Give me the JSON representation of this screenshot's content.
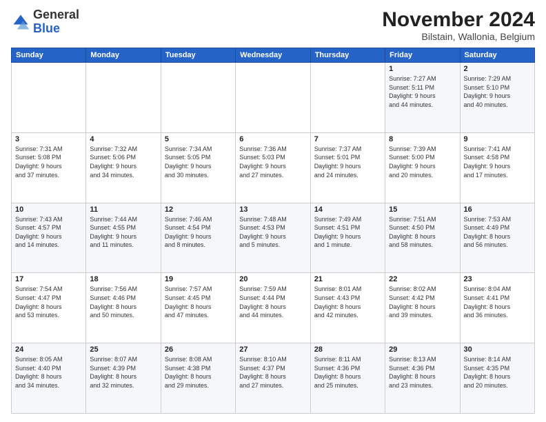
{
  "logo": {
    "general": "General",
    "blue": "Blue"
  },
  "title": "November 2024",
  "location": "Bilstain, Wallonia, Belgium",
  "headers": [
    "Sunday",
    "Monday",
    "Tuesday",
    "Wednesday",
    "Thursday",
    "Friday",
    "Saturday"
  ],
  "weeks": [
    [
      {
        "day": "",
        "info": ""
      },
      {
        "day": "",
        "info": ""
      },
      {
        "day": "",
        "info": ""
      },
      {
        "day": "",
        "info": ""
      },
      {
        "day": "",
        "info": ""
      },
      {
        "day": "1",
        "info": "Sunrise: 7:27 AM\nSunset: 5:11 PM\nDaylight: 9 hours\nand 44 minutes."
      },
      {
        "day": "2",
        "info": "Sunrise: 7:29 AM\nSunset: 5:10 PM\nDaylight: 9 hours\nand 40 minutes."
      }
    ],
    [
      {
        "day": "3",
        "info": "Sunrise: 7:31 AM\nSunset: 5:08 PM\nDaylight: 9 hours\nand 37 minutes."
      },
      {
        "day": "4",
        "info": "Sunrise: 7:32 AM\nSunset: 5:06 PM\nDaylight: 9 hours\nand 34 minutes."
      },
      {
        "day": "5",
        "info": "Sunrise: 7:34 AM\nSunset: 5:05 PM\nDaylight: 9 hours\nand 30 minutes."
      },
      {
        "day": "6",
        "info": "Sunrise: 7:36 AM\nSunset: 5:03 PM\nDaylight: 9 hours\nand 27 minutes."
      },
      {
        "day": "7",
        "info": "Sunrise: 7:37 AM\nSunset: 5:01 PM\nDaylight: 9 hours\nand 24 minutes."
      },
      {
        "day": "8",
        "info": "Sunrise: 7:39 AM\nSunset: 5:00 PM\nDaylight: 9 hours\nand 20 minutes."
      },
      {
        "day": "9",
        "info": "Sunrise: 7:41 AM\nSunset: 4:58 PM\nDaylight: 9 hours\nand 17 minutes."
      }
    ],
    [
      {
        "day": "10",
        "info": "Sunrise: 7:43 AM\nSunset: 4:57 PM\nDaylight: 9 hours\nand 14 minutes."
      },
      {
        "day": "11",
        "info": "Sunrise: 7:44 AM\nSunset: 4:55 PM\nDaylight: 9 hours\nand 11 minutes."
      },
      {
        "day": "12",
        "info": "Sunrise: 7:46 AM\nSunset: 4:54 PM\nDaylight: 9 hours\nand 8 minutes."
      },
      {
        "day": "13",
        "info": "Sunrise: 7:48 AM\nSunset: 4:53 PM\nDaylight: 9 hours\nand 5 minutes."
      },
      {
        "day": "14",
        "info": "Sunrise: 7:49 AM\nSunset: 4:51 PM\nDaylight: 9 hours\nand 1 minute."
      },
      {
        "day": "15",
        "info": "Sunrise: 7:51 AM\nSunset: 4:50 PM\nDaylight: 8 hours\nand 58 minutes."
      },
      {
        "day": "16",
        "info": "Sunrise: 7:53 AM\nSunset: 4:49 PM\nDaylight: 8 hours\nand 56 minutes."
      }
    ],
    [
      {
        "day": "17",
        "info": "Sunrise: 7:54 AM\nSunset: 4:47 PM\nDaylight: 8 hours\nand 53 minutes."
      },
      {
        "day": "18",
        "info": "Sunrise: 7:56 AM\nSunset: 4:46 PM\nDaylight: 8 hours\nand 50 minutes."
      },
      {
        "day": "19",
        "info": "Sunrise: 7:57 AM\nSunset: 4:45 PM\nDaylight: 8 hours\nand 47 minutes."
      },
      {
        "day": "20",
        "info": "Sunrise: 7:59 AM\nSunset: 4:44 PM\nDaylight: 8 hours\nand 44 minutes."
      },
      {
        "day": "21",
        "info": "Sunrise: 8:01 AM\nSunset: 4:43 PM\nDaylight: 8 hours\nand 42 minutes."
      },
      {
        "day": "22",
        "info": "Sunrise: 8:02 AM\nSunset: 4:42 PM\nDaylight: 8 hours\nand 39 minutes."
      },
      {
        "day": "23",
        "info": "Sunrise: 8:04 AM\nSunset: 4:41 PM\nDaylight: 8 hours\nand 36 minutes."
      }
    ],
    [
      {
        "day": "24",
        "info": "Sunrise: 8:05 AM\nSunset: 4:40 PM\nDaylight: 8 hours\nand 34 minutes."
      },
      {
        "day": "25",
        "info": "Sunrise: 8:07 AM\nSunset: 4:39 PM\nDaylight: 8 hours\nand 32 minutes."
      },
      {
        "day": "26",
        "info": "Sunrise: 8:08 AM\nSunset: 4:38 PM\nDaylight: 8 hours\nand 29 minutes."
      },
      {
        "day": "27",
        "info": "Sunrise: 8:10 AM\nSunset: 4:37 PM\nDaylight: 8 hours\nand 27 minutes."
      },
      {
        "day": "28",
        "info": "Sunrise: 8:11 AM\nSunset: 4:36 PM\nDaylight: 8 hours\nand 25 minutes."
      },
      {
        "day": "29",
        "info": "Sunrise: 8:13 AM\nSunset: 4:36 PM\nDaylight: 8 hours\nand 23 minutes."
      },
      {
        "day": "30",
        "info": "Sunrise: 8:14 AM\nSunset: 4:35 PM\nDaylight: 8 hours\nand 20 minutes."
      }
    ]
  ]
}
